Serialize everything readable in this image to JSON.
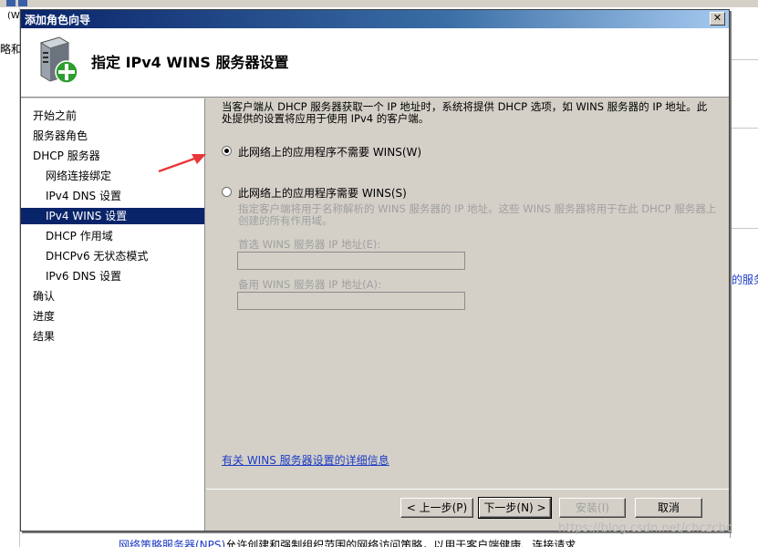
{
  "background": {
    "left_fragment_top": "(W",
    "left_fragment_2": "略和",
    "right_fragment": "的服务",
    "bottom_link": "网络策略服务器(NPS)",
    "bottom_text": "允许创建和强制组织范围的网络访问策略，以用于客户端健康、连接请求",
    "watermark": "https://blog.csdn.net/chczcbc"
  },
  "window": {
    "title": "添加角色向导",
    "close_glyph": "✕"
  },
  "header": {
    "title": "指定 IPv4 WINS 服务器设置",
    "icon": "server-role-add-icon"
  },
  "nav": {
    "items": [
      {
        "label": "开始之前",
        "indent": false,
        "active": false
      },
      {
        "label": "服务器角色",
        "indent": false,
        "active": false
      },
      {
        "label": "DHCP 服务器",
        "indent": false,
        "active": false
      },
      {
        "label": "网络连接绑定",
        "indent": true,
        "active": false
      },
      {
        "label": "IPv4 DNS 设置",
        "indent": true,
        "active": false
      },
      {
        "label": "IPv4 WINS 设置",
        "indent": true,
        "active": true
      },
      {
        "label": "DHCP 作用域",
        "indent": true,
        "active": false
      },
      {
        "label": "DHCPv6 无状态模式",
        "indent": true,
        "active": false
      },
      {
        "label": "IPv6 DNS 设置",
        "indent": true,
        "active": false
      },
      {
        "label": "确认",
        "indent": false,
        "active": false
      },
      {
        "label": "进度",
        "indent": false,
        "active": false
      },
      {
        "label": "结果",
        "indent": false,
        "active": false
      }
    ]
  },
  "content": {
    "description": "当客户端从 DHCP 服务器获取一个 IP 地址时，系统将提供 DHCP 选项，如 WINS 服务器的 IP 地址。此处提供的设置将应用于使用 IPv4 的客户端。",
    "option_not_required": "此网络上的应用程序不需要 WINS(W)",
    "option_required": "此网络上的应用程序需要 WINS(S)",
    "option_required_desc": "指定客户端将用于名称解析的 WINS 服务器的 IP 地址。这些 WINS 服务器将用于在此 DHCP 服务器上创建的所有作用域。",
    "preferred_label": "首选 WINS 服务器 IP 地址(E):",
    "preferred_value": "",
    "alternate_label": "备用 WINS 服务器 IP 地址(A):",
    "alternate_value": "",
    "help_link": "有关 WINS 服务器设置的详细信息"
  },
  "buttons": {
    "back": "< 上一步(P)",
    "next": "下一步(N) >",
    "install": "安装(I)",
    "cancel": "取消"
  },
  "colors": {
    "selection": "#0a246a",
    "annotation_arrow": "#e8383a",
    "link": "#1d3cc4"
  }
}
